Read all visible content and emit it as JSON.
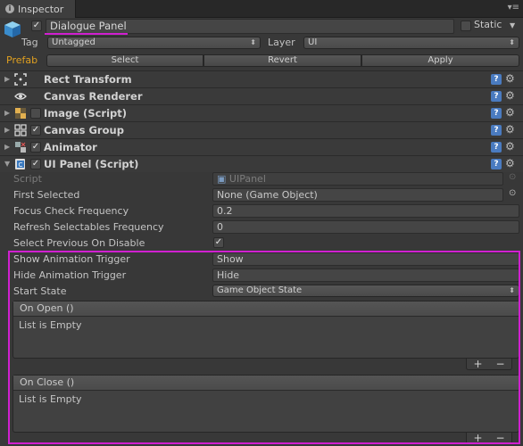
{
  "window": {
    "tab_label": "Inspector",
    "menu_glyph": "▾≡"
  },
  "header": {
    "object_active": true,
    "object_name": "Dialogue Panel",
    "static_label": "Static",
    "static_checked": false,
    "tag_label": "Tag",
    "tag_value": "Untagged",
    "layer_label": "Layer",
    "layer_value": "UI",
    "prefab_label": "Prefab",
    "prefab_select": "Select",
    "prefab_revert": "Revert",
    "prefab_apply": "Apply"
  },
  "components": [
    {
      "name": "Rect Transform",
      "icon": "rect-transform-icon",
      "has_checkbox": false
    },
    {
      "name": "Canvas Renderer",
      "icon": "eye-icon",
      "has_checkbox": false
    },
    {
      "name": "Image (Script)",
      "icon": "image-icon",
      "has_checkbox": true,
      "checked": false
    },
    {
      "name": "Canvas Group",
      "icon": "grid-icon",
      "has_checkbox": true,
      "checked": true
    },
    {
      "name": "Animator",
      "icon": "animator-icon",
      "has_checkbox": true,
      "checked": true
    },
    {
      "name": "UI Panel (Script)",
      "icon": "script-icon",
      "has_checkbox": true,
      "checked": true
    }
  ],
  "ui_panel": {
    "script_label": "Script",
    "script_value": "UIPanel",
    "first_selected_label": "First Selected",
    "first_selected_value": "None (Game Object)",
    "focus_label": "Focus Check Frequency",
    "focus_value": "0.2",
    "refresh_label": "Refresh Selectables Frequency",
    "refresh_value": "0",
    "select_prev_label": "Select Previous On Disable",
    "select_prev_checked": true,
    "show_trigger_label": "Show Animation Trigger",
    "show_trigger_value": "Show",
    "hide_trigger_label": "Hide Animation Trigger",
    "hide_trigger_value": "Hide",
    "start_state_label": "Start State",
    "start_state_value": "Game Object State",
    "on_open_label": "On Open ()",
    "on_open_empty": "List is Empty",
    "on_close_label": "On Close ()",
    "on_close_empty": "List is Empty",
    "add_glyph": "+",
    "remove_glyph": "−"
  },
  "colors": {
    "highlight": "#d020d0",
    "prefab_label": "#e0a020",
    "help_icon": "#4a7bc0"
  }
}
